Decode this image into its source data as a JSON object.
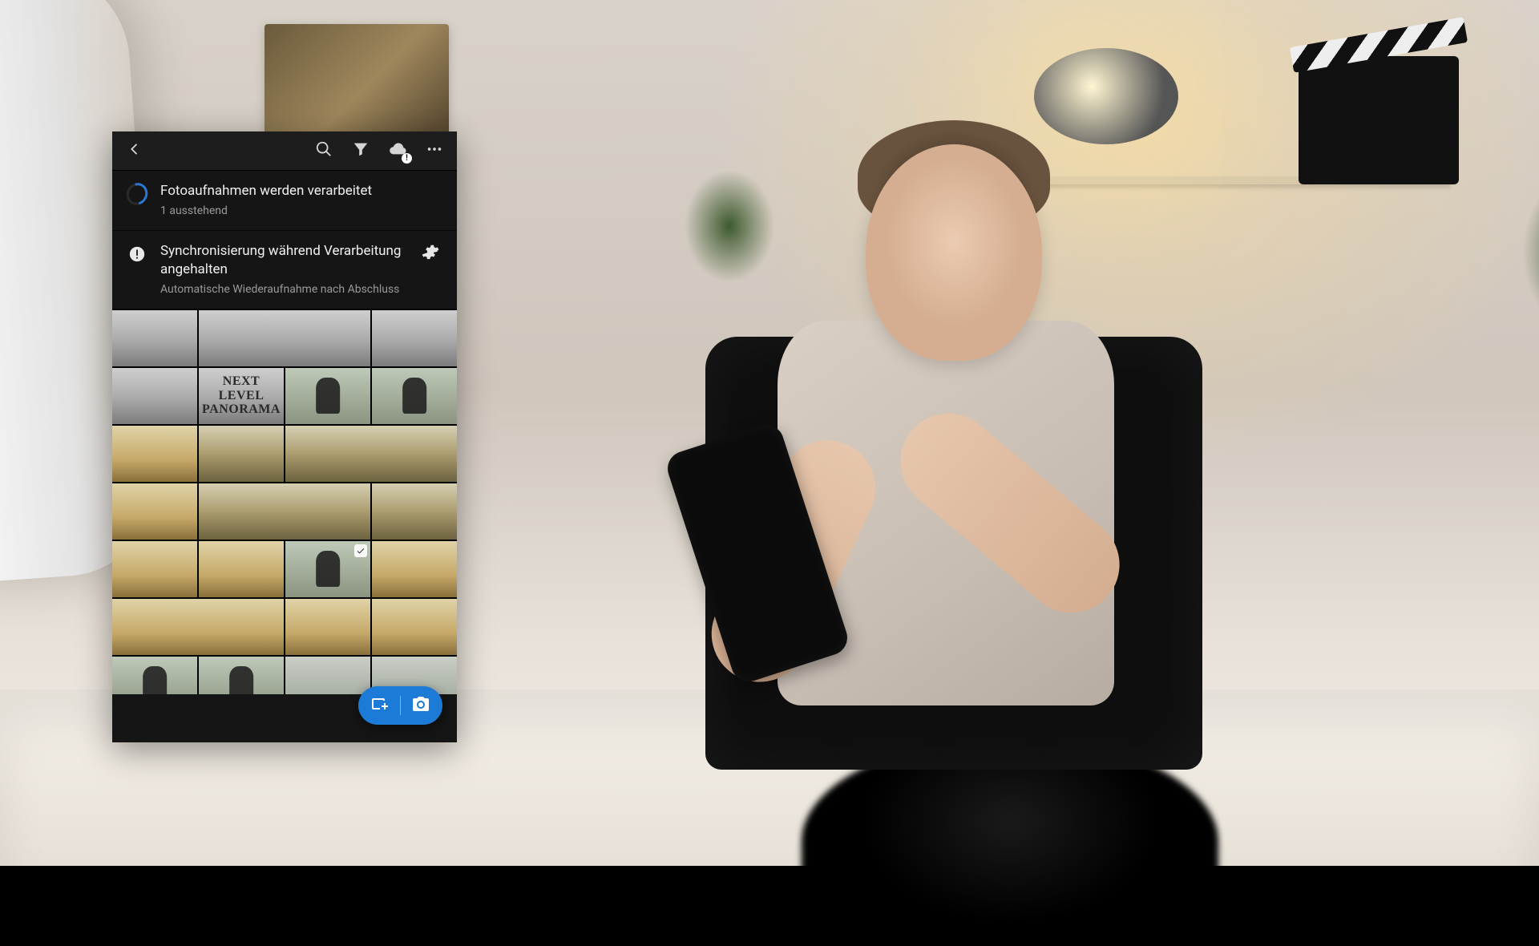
{
  "toolbar": {
    "cloud_badge": "!"
  },
  "status": {
    "processing": {
      "title": "Fotoaufnahmen werden verarbeitet",
      "sub": "1 ausstehend"
    },
    "sync": {
      "title": "Synchronisierung während Verarbeitung angehalten",
      "sub": "Automatische Wiederaufnahme nach Abschluss"
    }
  },
  "grid": {
    "thumb_caption": "NEXT LEVEL PANORAMA"
  },
  "accent_color": "#1c7bd6"
}
